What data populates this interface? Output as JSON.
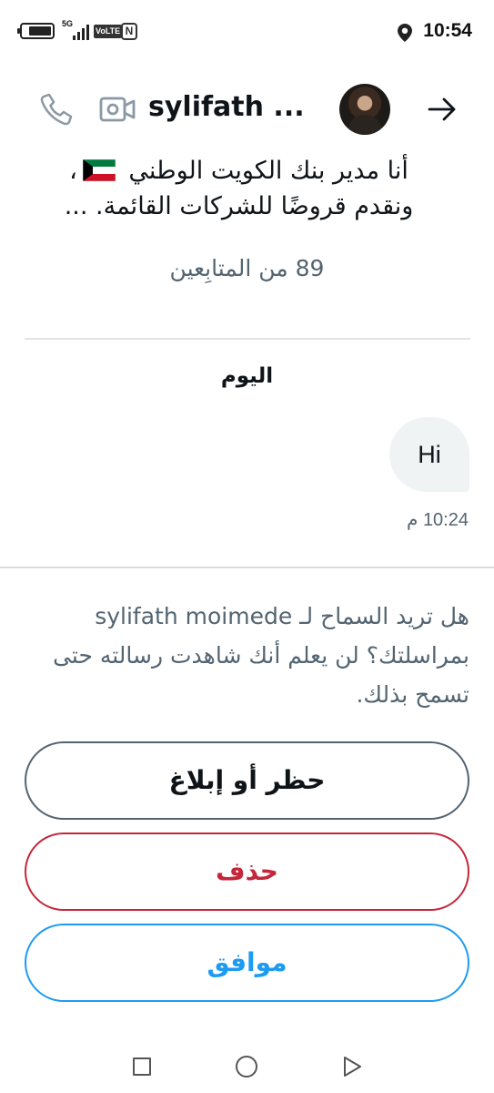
{
  "status_bar": {
    "network": "5G",
    "volte": "VoLTE",
    "nfc": "N",
    "time": "10:54",
    "battery_level": 0.8,
    "icons": [
      "battery-charging-icon",
      "signal-icon",
      "nfc-icon",
      "location-icon"
    ]
  },
  "header": {
    "contact_name": "sylifath ...",
    "icons": [
      "phone-icon",
      "video-icon",
      "avatar",
      "back-arrow-icon"
    ]
  },
  "bio": {
    "line1": "أنا مدير بنك الكويت الوطني",
    "line2": "، ونقدم قروضًا للشركات القائمة. ...",
    "flag": "kuwait-flag-icon"
  },
  "followers": "89 من المتابِعين",
  "conversation": {
    "day_label": "اليوم",
    "messages": [
      {
        "text": "Hi",
        "time": "10:24 م",
        "sent": true
      }
    ]
  },
  "request": {
    "text": "هل تريد السماح لـ sylifath moimede بمراسلتك؟ لن يعلم أنك شاهدت رسالته حتى تسمح بذلك."
  },
  "buttons": {
    "block_report": "حظر أو إبلاغ",
    "delete": "حذف",
    "accept": "موافق"
  },
  "colors": {
    "primary_text": "#0f1419",
    "secondary_text": "#536471",
    "danger": "#c4273a",
    "accent": "#1d9bf0",
    "bubble": "#eff3f4"
  }
}
